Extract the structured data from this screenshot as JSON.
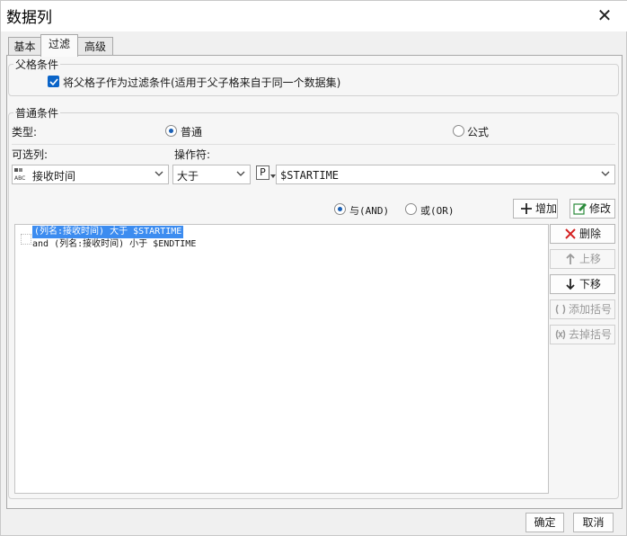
{
  "window": {
    "title": "数据列",
    "close_glyph": "✕"
  },
  "tabs": [
    {
      "label": "基本",
      "active": false
    },
    {
      "label": "过滤",
      "active": true
    },
    {
      "label": "高级",
      "active": false
    }
  ],
  "parent_condition": {
    "group_title": "父格条件",
    "checkbox_label": "将父格子作为过滤条件(适用于父子格来自于同一个数据集)",
    "checked": true
  },
  "normal_condition": {
    "group_title": "普通条件",
    "type_label": "类型:",
    "type_options": [
      {
        "label": "普通",
        "selected": true
      },
      {
        "label": "公式",
        "selected": false
      }
    ],
    "column_label": "可选列:",
    "operator_label": "操作符:",
    "column_value": "接收时间",
    "operator_value": "大于",
    "param_badge": "P",
    "value_text": "$STARTIME",
    "logic_options": [
      {
        "label": "与(AND)",
        "selected": true
      },
      {
        "label": "或(OR)",
        "selected": false
      }
    ],
    "add_button": "增加",
    "edit_button": "修改"
  },
  "conditions": [
    {
      "text": "(列名:接收时间) 大于 $STARTIME",
      "selected": true
    },
    {
      "text": "and (列名:接收时间) 小于 $ENDTIME",
      "selected": false
    }
  ],
  "side_buttons": [
    {
      "label": "删除",
      "enabled": true,
      "icon": "delete-x-icon",
      "color": "#d42020"
    },
    {
      "label": "上移",
      "enabled": false,
      "icon": "arrow-up-icon",
      "color": "#9a9a9a"
    },
    {
      "label": "下移",
      "enabled": true,
      "icon": "arrow-down-icon",
      "color": "#222222"
    },
    {
      "label": "添加括号",
      "enabled": false,
      "icon": "add-bracket-icon",
      "color": "#9a9a9a"
    },
    {
      "label": "去掉括号",
      "enabled": false,
      "icon": "remove-bracket-icon",
      "color": "#9a9a9a"
    }
  ],
  "footer": {
    "ok": "确定",
    "cancel": "取消"
  },
  "colors": {
    "selection": "#3c8cf0",
    "checkbox": "#0a64c8"
  }
}
